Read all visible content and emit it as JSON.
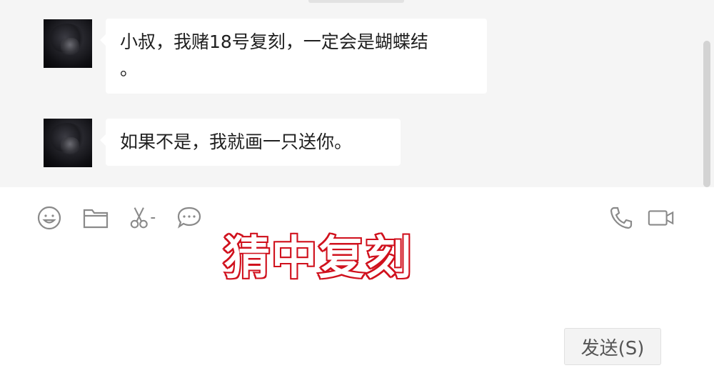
{
  "chat": {
    "messages": [
      {
        "avatar_icon": "contact-avatar",
        "text_line1": "小叔，我赌18号复刻，一定会是蝴蝶结",
        "text_line2": "。"
      },
      {
        "avatar_icon": "contact-avatar",
        "text": "如果不是，我就画一只送你。"
      }
    ]
  },
  "toolbar": {
    "left_icons": [
      "emoji-icon",
      "folder-icon",
      "scissors-icon",
      "chat-bubble-icon"
    ],
    "right_icons": [
      "phone-icon",
      "video-icon"
    ]
  },
  "overlay": {
    "caption": "猜中复刻"
  },
  "send": {
    "label": "发送(S)"
  },
  "colors": {
    "chat_bg": "#f5f5f5",
    "bubble_bg": "#ffffff",
    "caption_fill": "#ffffff",
    "caption_outline": "#d0111d"
  }
}
